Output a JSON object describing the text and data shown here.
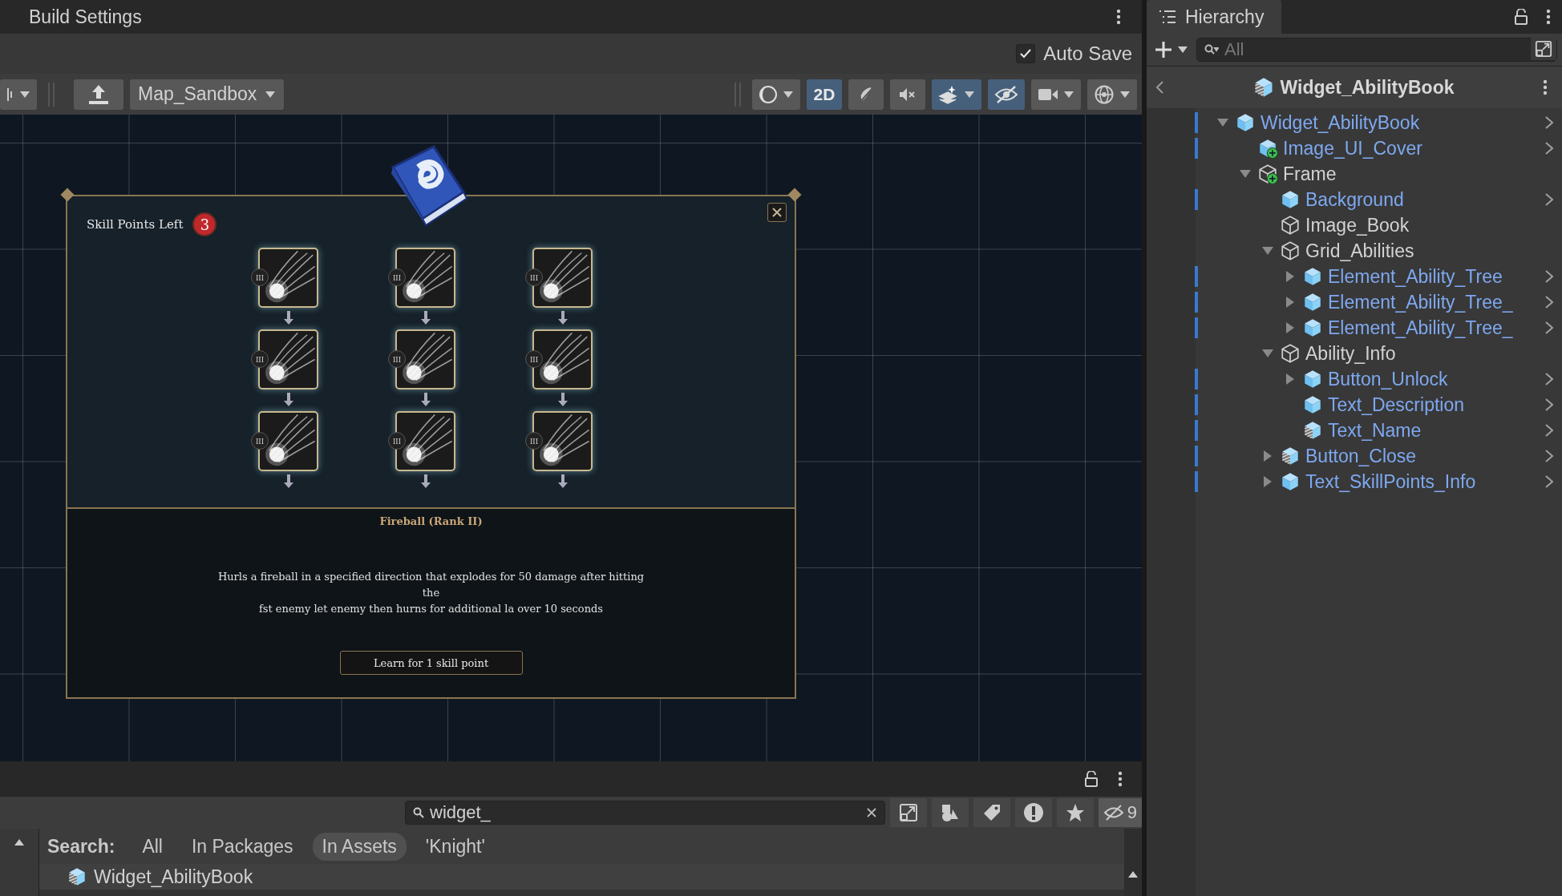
{
  "top_panel": {
    "title": "Build Settings"
  },
  "auto_save": {
    "label": "Auto Save",
    "checked": true
  },
  "scene_toolbar": {
    "scene_name": "Map_Sandbox",
    "tools": [
      {
        "kind": "shading",
        "selected": false,
        "dropdown": true
      },
      {
        "kind": "mode",
        "label": "2D",
        "selected": true,
        "dropdown": false
      },
      {
        "kind": "lighting",
        "selected": false,
        "dropdown": false
      },
      {
        "kind": "audio",
        "selected": false,
        "dropdown": false
      },
      {
        "kind": "effects",
        "selected": true,
        "dropdown": true
      },
      {
        "kind": "visibility",
        "selected": true,
        "dropdown": false
      },
      {
        "kind": "camera",
        "selected": false,
        "dropdown": true
      },
      {
        "kind": "gizmos",
        "selected": false,
        "dropdown": true
      }
    ]
  },
  "game_ui": {
    "skill_points_label": "Skill Points Left",
    "skill_points": "3",
    "ability_slots": [
      {
        "rank": "III"
      },
      {
        "rank": "III"
      },
      {
        "rank": "III"
      },
      {
        "rank": "III"
      },
      {
        "rank": "III"
      },
      {
        "rank": "III"
      },
      {
        "rank": "III"
      },
      {
        "rank": "III"
      },
      {
        "rank": "III"
      }
    ],
    "ability_title": "Fireball (Rank II)",
    "description": [
      "Hurls a fireball in a specified direction that explodes for 50 damage after hitting",
      "the",
      "fst enemy let enemy then hurns for additional la over 10 seconds"
    ],
    "learn_button": "Learn for 1 skill point"
  },
  "hierarchy": {
    "title": "Hierarchy",
    "search": {
      "placeholder": "All"
    },
    "breadcrumb": "Widget_AbilityBook",
    "tree": [
      {
        "name": "Widget_AbilityBook",
        "kind": "prefab",
        "has_children": true,
        "expanded": true,
        "children": [
          {
            "name": "Image_UI_Cover",
            "kind": "prefabadded",
            "has_children": false,
            "expanded": false
          },
          {
            "name": "Frame",
            "kind": "objectadded",
            "has_children": true,
            "expanded": true,
            "children": [
              {
                "name": "Background",
                "kind": "prefab",
                "has_children": false,
                "expanded": false
              },
              {
                "name": "Image_Book",
                "kind": "object",
                "has_children": false,
                "expanded": false
              },
              {
                "name": "Grid_Abilities",
                "kind": "object",
                "has_children": true,
                "expanded": true,
                "children": [
                  {
                    "name": "Element_Ability_Tree",
                    "kind": "prefab",
                    "has_children": true,
                    "expanded": false
                  },
                  {
                    "name": "Element_Ability_Tree_",
                    "kind": "prefab",
                    "has_children": true,
                    "expanded": false
                  },
                  {
                    "name": "Element_Ability_Tree_",
                    "kind": "prefab",
                    "has_children": true,
                    "expanded": false
                  }
                ]
              },
              {
                "name": "Ability_Info",
                "kind": "object",
                "has_children": true,
                "expanded": true,
                "children": [
                  {
                    "name": "Button_Unlock",
                    "kind": "prefab",
                    "has_children": true,
                    "expanded": false
                  },
                  {
                    "name": "Text_Description",
                    "kind": "prefab",
                    "has_children": false,
                    "expanded": false
                  },
                  {
                    "name": "Text_Name",
                    "kind": "variant",
                    "has_children": false,
                    "expanded": false
                  }
                ]
              },
              {
                "name": "Button_Close",
                "kind": "variant",
                "has_children": true,
                "expanded": false
              },
              {
                "name": "Text_SkillPoints_Info",
                "kind": "prefab",
                "has_children": true,
                "expanded": false
              }
            ]
          }
        ]
      }
    ]
  },
  "project": {
    "search": {
      "value": "widget_"
    },
    "hidden_count": "9",
    "search_label": "Search:",
    "filters": [
      {
        "label": "All",
        "selected": false
      },
      {
        "label": "In Packages",
        "selected": false
      },
      {
        "label": "In Assets",
        "selected": true
      },
      {
        "label": "'Knight'",
        "selected": false
      }
    ],
    "results": [
      {
        "name": "Widget_AbilityBook",
        "kind": "variant",
        "selected": true
      }
    ]
  }
}
